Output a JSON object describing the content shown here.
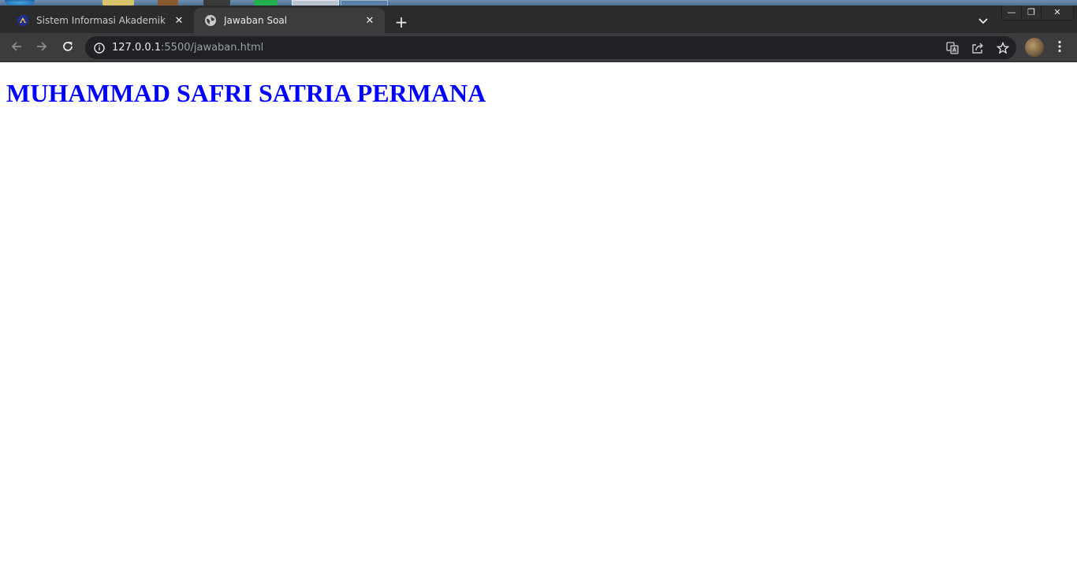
{
  "browser": {
    "tabs": [
      {
        "title": "Sistem Informasi Akademik",
        "active": false,
        "favicon": "campus-logo-icon"
      },
      {
        "title": "Jawaban Soal",
        "active": true,
        "favicon": "globe-icon"
      }
    ],
    "tab_close_glyph": "✕",
    "new_tab_glyph": "+",
    "address_bar": {
      "host": "127.0.0.1",
      "rest": ":5500/jawaban.html"
    },
    "window_controls": {
      "minimize": "—",
      "restore": "❐",
      "close": "✕"
    }
  },
  "page": {
    "heading": "MUHAMMAD SAFRI SATRIA PERMANA",
    "heading_color": "#0000ff"
  },
  "colors": {
    "tabstrip_bg": "#2b2b2d",
    "toolbar_bg": "#3c3c3e",
    "omnibox_bg": "#202124",
    "page_bg": "#ffffff"
  }
}
